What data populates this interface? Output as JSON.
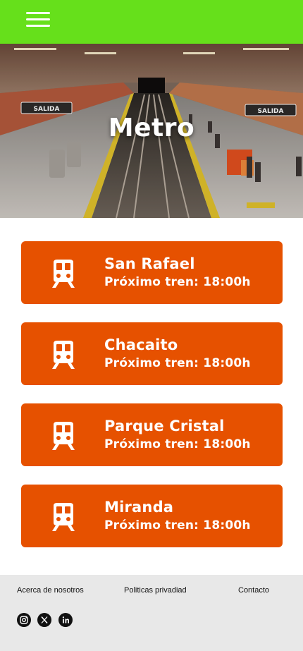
{
  "header": {
    "menu_icon": "hamburger-menu-icon"
  },
  "hero": {
    "title": "Metro",
    "sign_left": "SALIDA",
    "sign_right": "SALIDA"
  },
  "stations": [
    {
      "name": "San Rafael",
      "next_train": "Próximo tren: 18:00h",
      "icon": "train-icon"
    },
    {
      "name": "Chacaito",
      "next_train": "Próximo tren: 18:00h",
      "icon": "train-icon"
    },
    {
      "name": "Parque Cristal",
      "next_train": "Próximo tren: 18:00h",
      "icon": "train-icon"
    },
    {
      "name": "Miranda",
      "next_train": "Próximo tren: 18:00h",
      "icon": "train-icon"
    }
  ],
  "footer": {
    "links": {
      "about": "Acerca de nosotros",
      "privacy": "Politicas privadiad",
      "contact": "Contacto"
    },
    "social": [
      "instagram-icon",
      "x-icon",
      "linkedin-icon"
    ]
  },
  "colors": {
    "header": "#66e01b",
    "card": "#e65100",
    "footer": "#e8e8e8"
  }
}
